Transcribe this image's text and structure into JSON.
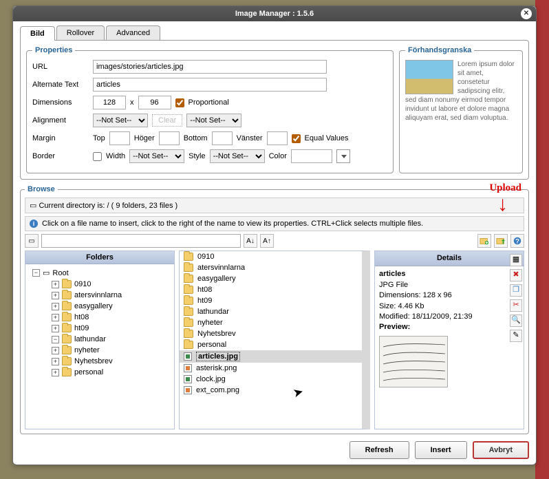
{
  "window": {
    "title": "Image Manager : 1.5.6"
  },
  "tabs": {
    "bild": "Bild",
    "rollover": "Rollover",
    "advanced": "Advanced"
  },
  "props": {
    "legend": "Properties",
    "url_label": "URL",
    "url": "images/stories/articles.jpg",
    "alt_label": "Alternate Text",
    "alt": "articles",
    "dim_label": "Dimensions",
    "w": "128",
    "x": "x",
    "h": "96",
    "proportional": "Proportional",
    "align_label": "Alignment",
    "notset": "--Not Set--",
    "clear": "Clear",
    "margin_label": "Margin",
    "top": "Top",
    "right": "Höger",
    "bottom": "Bottom",
    "left": "Vänster",
    "equal": "Equal Values",
    "border_label": "Border",
    "width": "Width",
    "style": "Style",
    "color": "Color"
  },
  "preview": {
    "legend": "Förhandsgranska",
    "lorem": "Lorem ipsum dolor sit amet, consetetur sadipscing elitr, sed diam nonumy eirmod tempor invidunt ut labore et dolore magna aliquyam erat, sed diam voluptua."
  },
  "browse": {
    "legend": "Browse",
    "path": "Current directory is: / ( 9 folders, 23 files )",
    "info": "Click on a file name to insert, click to the right of the name to view its properties. CTRL+Click selects multiple files.",
    "folders_h": "Folders",
    "details_h": "Details",
    "root": "Root",
    "tree": [
      "0910",
      "atersvinnlarna",
      "easygallery",
      "ht08",
      "ht09",
      "lathundar",
      "nyheter",
      "Nyhetsbrev",
      "personal"
    ],
    "files_folders": [
      "0910",
      "atersvinnlarna",
      "easygallery",
      "ht08",
      "ht09",
      "lathundar",
      "nyheter",
      "Nyhetsbrev",
      "personal"
    ],
    "selected_file": "articles.jpg",
    "files_images": [
      "asterisk.png",
      "clock.jpg",
      "ext_com.png"
    ]
  },
  "details": {
    "name": "articles",
    "type": "JPG File",
    "dims_label": "Dimensions:",
    "dims": "128 x 96",
    "size_label": "Size:",
    "size": "4.46 Kb",
    "mod_label": "Modified:",
    "mod": "18/11/2009, 21:39",
    "preview_label": "Preview:"
  },
  "buttons": {
    "refresh": "Refresh",
    "insert": "Insert",
    "cancel": "Avbryt"
  },
  "annot": {
    "upload": "Upload"
  }
}
